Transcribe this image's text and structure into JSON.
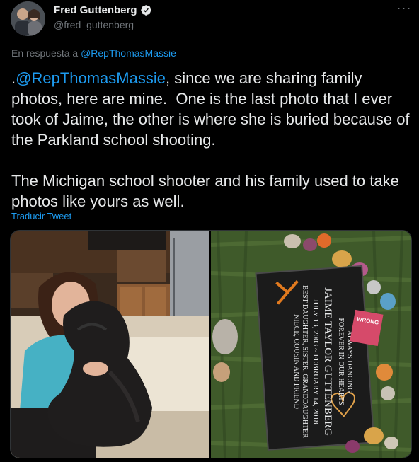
{
  "tweet": {
    "author": {
      "display_name": "Fred Guttenberg",
      "handle": "@fred_guttenberg",
      "verified": true
    },
    "reply_prefix": "En respuesta a ",
    "reply_mention": "@RepThomasMassie",
    "text_lead": ".",
    "text_mention": "@RepThomasMassie",
    "text_body": ", since we are sharing family photos, here are mine.  One is the last photo that I ever took of Jaime, the other is where she is buried because of the Parkland school shooting.\n\nThe Michigan school shooter and his family used to take photos like yours as well.",
    "translate_label": "Traducir Tweet",
    "more_label": "···",
    "grave": {
      "line1": "ALWAYS DANCING",
      "line2": "FOREVER IN OUR HEARTS",
      "line3": "JAIME TAYLOR GUTTENBERG",
      "line4": "JULY 13, 2003 ~ FEBRUARY 14, 2018",
      "line5": "BEST DAUGHTER, SISTER, GRANDDAUGHTER",
      "line6": "NIECE, COUSIN AND FRIEND",
      "flag_text": "WRONG"
    }
  },
  "colors": {
    "accent": "#1d9bf0",
    "text": "#e7e9ea",
    "muted": "#71767b",
    "background": "#000000"
  },
  "icons": {
    "verified": "verified-badge-icon",
    "more": "more-options-icon"
  }
}
